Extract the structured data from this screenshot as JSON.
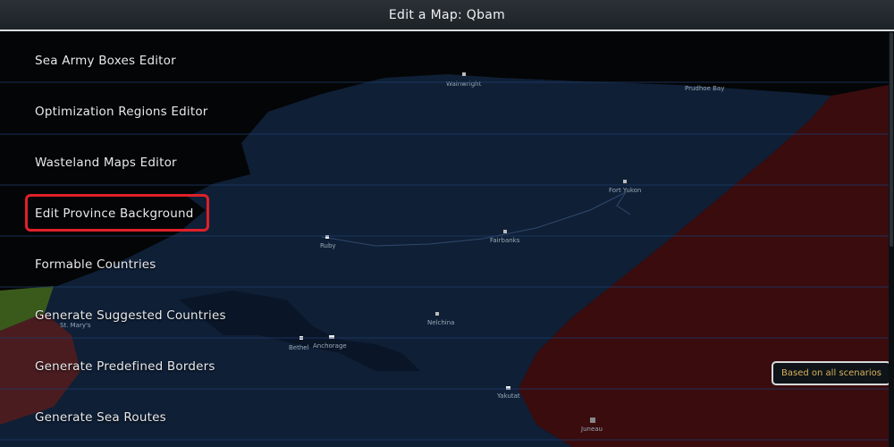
{
  "window": {
    "title": "Edit a Map: Qbam"
  },
  "menu": {
    "items": [
      {
        "label": "Sea Army Boxes Editor"
      },
      {
        "label": "Optimization Regions Editor"
      },
      {
        "label": "Wasteland Maps Editor"
      },
      {
        "label": "Edit Province Background",
        "highlighted": true
      },
      {
        "label": "Formable Countries"
      },
      {
        "label": "Generate Suggested Countries"
      },
      {
        "label": "Generate Predefined Borders"
      },
      {
        "label": "Generate Sea Routes"
      }
    ]
  },
  "map": {
    "cities": [
      "Wainwright",
      "Prudhoe Bay",
      "Fort Yukon",
      "Ruby",
      "Fairbanks",
      "Nelchina",
      "St. Mary's",
      "Bethel",
      "Anchorage",
      "Yakutat",
      "Juneau"
    ]
  },
  "status": {
    "badge": "Based on all scenarios"
  },
  "colors": {
    "title_bg": "#252b31",
    "land_blue": "#10203a",
    "territory_red": "#3a0c0d",
    "highlight": "#e0202a",
    "badge_text": "#d8b25a"
  }
}
